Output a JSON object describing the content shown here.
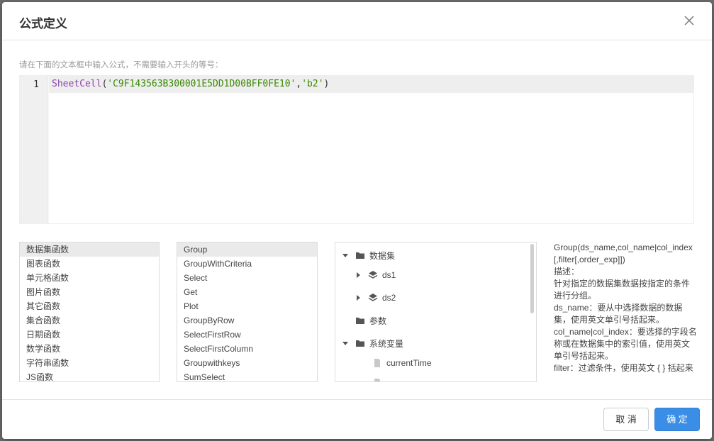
{
  "dialog": {
    "title": "公式定义",
    "hint": "请在下面的文本框中输入公式，不需要输入开头的等号："
  },
  "editor": {
    "line_number": "1",
    "fn_name": "SheetCell",
    "open_paren": "(",
    "arg1": "'C9F143563B300001E5DD1D00BFF0FE10'",
    "comma": ",",
    "arg2": "'b2'",
    "close_paren": ")"
  },
  "categories": [
    "数据集函数",
    "图表函数",
    "单元格函数",
    "图片函数",
    "其它函数",
    "集合函数",
    "日期函数",
    "数学函数",
    "字符串函数",
    "JS函数"
  ],
  "functions": [
    "Group",
    "GroupWithCriteria",
    "Select",
    "Get",
    "Plot",
    "GroupByRow",
    "SelectFirstRow",
    "SelectFirstColumn",
    "Groupwithkeys",
    "SumSelect"
  ],
  "tree": {
    "dataset_root": "数据集",
    "ds1": "ds1",
    "ds2": "ds2",
    "params": "参数",
    "sysvars": "系统变量",
    "current_time": "currentTime"
  },
  "description": [
    "Group(ds_name,col_name|col_index[,filter[,order_exp]])",
    "描述：",
    "针对指定的数据集数据按指定的条件进行分组。",
    "ds_name：要从中选择数据的数据集，使用英文单引号括起来。",
    "col_name|col_index：要选择的字段名称或在数据集中的索引值，使用英文单引号括起来。",
    "filter：过滤条件，使用英文 { } 括起来"
  ],
  "footer": {
    "cancel_label": "取 消",
    "ok_label": "确 定"
  },
  "colors": {
    "primary": "#3a8ee6",
    "function_name": "#8e44ad",
    "string": "#3a8a00"
  }
}
